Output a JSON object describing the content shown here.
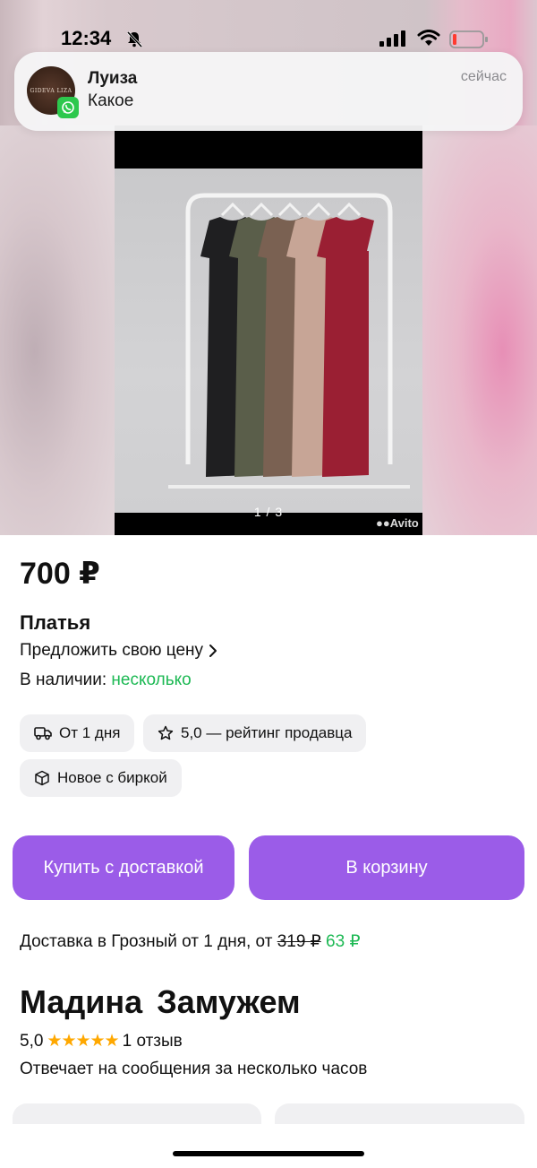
{
  "status_bar": {
    "time": "12:34"
  },
  "notification": {
    "avatar_text": "GIDEVA LIZA",
    "sender": "Луиза",
    "message": "Какое",
    "time": "сейчас",
    "app_badge_icon": "whatsapp-icon"
  },
  "gallery": {
    "counter": "1 / 3",
    "watermark": "Avito",
    "dress_colors": [
      "#1f1f21",
      "#5a5e4a",
      "#7a6152",
      "#c7a596",
      "#9a1f33"
    ]
  },
  "product": {
    "price": "700 ₽",
    "title": "Платья",
    "offer_link": "Предложить свою цену",
    "availability_label": "В наличии:",
    "availability_value": "несколько"
  },
  "chips": {
    "delivery": "От 1 дня",
    "rating": "5,0 — рейтинг продавца",
    "condition": "Новое с биркой"
  },
  "buttons": {
    "buy": "Купить с доставкой",
    "cart": "В корзину"
  },
  "delivery": {
    "text": "Доставка в Грозный от 1 дня, от",
    "old_price": "319 ₽",
    "new_price": "63 ₽"
  },
  "seller": {
    "name": "Мадина  Замужем",
    "rating": "5,0",
    "stars": "★★★★★",
    "reviews": "1 отзыв",
    "response": "Отвечает на сообщения за несколько часов"
  },
  "colors": {
    "accent": "#9b5ce8",
    "green": "#1db954",
    "star": "#ffa800"
  }
}
